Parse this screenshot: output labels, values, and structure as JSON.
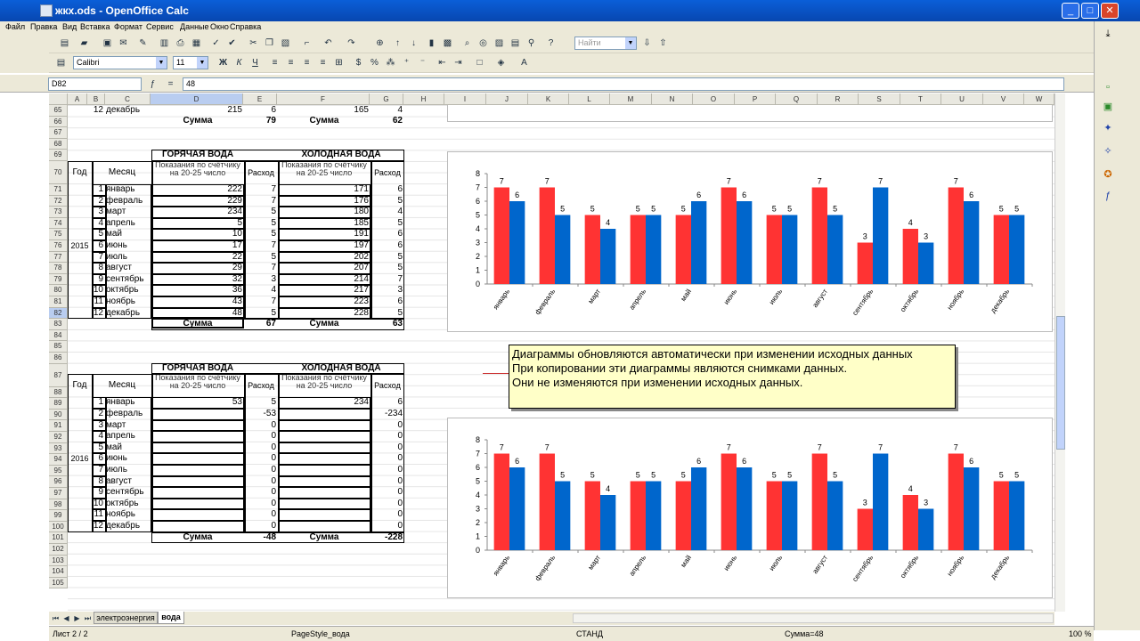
{
  "window": {
    "title": "жкх.ods - OpenOffice Calc",
    "min": "_",
    "max": "□",
    "close": "✕"
  },
  "menu": [
    "Файл",
    "Правка",
    "Вид",
    "Вставка",
    "Формат",
    "Сервис",
    "Данные",
    "Окно",
    "Справка"
  ],
  "toolbar": {
    "style_value": "Найти",
    "font_name": "Calibri",
    "font_size": "11"
  },
  "formula": {
    "cell_ref": "D82",
    "value": "48"
  },
  "columns": [
    "A",
    "B",
    "C",
    "D",
    "E",
    "F",
    "G",
    "H",
    "I",
    "J",
    "K",
    "L",
    "M",
    "N",
    "O",
    "P",
    "Q",
    "R",
    "S",
    "T",
    "U",
    "V",
    "W"
  ],
  "rows": [
    "65",
    "66",
    "67",
    "68",
    "69",
    "70",
    "71",
    "72",
    "73",
    "74",
    "75",
    "76",
    "77",
    "78",
    "79",
    "80",
    "81",
    "82",
    "83",
    "84",
    "85",
    "86",
    "87",
    "88",
    "89",
    "90",
    "91",
    "92",
    "93",
    "94",
    "95",
    "96",
    "97",
    "98",
    "99",
    "100",
    "101",
    "102",
    "103",
    "104",
    "105"
  ],
  "table_top": {
    "row65": {
      "num": "12",
      "month": "декабрь",
      "hot": "215",
      "hot_use": "6",
      "cold": "165",
      "cold_use": "4"
    },
    "row66": {
      "sum_label": "Сумма",
      "hot_sum": "79",
      "cold_sum": "62"
    }
  },
  "table2015": {
    "hot_header": "ГОРЯЧАЯ ВОДА",
    "cold_header": "ХОЛОДНАЯ ВОДА",
    "year_header": "Год",
    "month_header": "Месяц",
    "reading_header": "Показания по счётчику на 20-25 число",
    "use_header": "Расход",
    "year": "2015",
    "rows": [
      {
        "n": "1",
        "m": "январь",
        "h": "222",
        "hu": "7",
        "c": "171",
        "cu": "6"
      },
      {
        "n": "2",
        "m": "февраль",
        "h": "229",
        "hu": "7",
        "c": "176",
        "cu": "5"
      },
      {
        "n": "3",
        "m": "март",
        "h": "234",
        "hu": "5",
        "c": "180",
        "cu": "4"
      },
      {
        "n": "4",
        "m": "апрель",
        "h": "5",
        "hu": "5",
        "c": "185",
        "cu": "5"
      },
      {
        "n": "5",
        "m": "май",
        "h": "10",
        "hu": "5",
        "c": "191",
        "cu": "6"
      },
      {
        "n": "6",
        "m": "июнь",
        "h": "17",
        "hu": "7",
        "c": "197",
        "cu": "6"
      },
      {
        "n": "7",
        "m": "июль",
        "h": "22",
        "hu": "5",
        "c": "202",
        "cu": "5"
      },
      {
        "n": "8",
        "m": "август",
        "h": "29",
        "hu": "7",
        "c": "207",
        "cu": "5"
      },
      {
        "n": "9",
        "m": "сентябрь",
        "h": "32",
        "hu": "3",
        "c": "214",
        "cu": "7"
      },
      {
        "n": "10",
        "m": "октябрь",
        "h": "36",
        "hu": "4",
        "c": "217",
        "cu": "3"
      },
      {
        "n": "11",
        "m": "ноябрь",
        "h": "43",
        "hu": "7",
        "c": "223",
        "cu": "6"
      },
      {
        "n": "12",
        "m": "декабрь",
        "h": "48",
        "hu": "5",
        "c": "228",
        "cu": "5"
      }
    ],
    "sum_label": "Сумма",
    "hot_sum": "67",
    "cold_sum": "63"
  },
  "table2016": {
    "hot_header": "ГОРЯЧАЯ ВОДА",
    "cold_header": "ХОЛОДНАЯ ВОДА",
    "year_header": "Год",
    "month_header": "Месяц",
    "reading_header": "Показания по счётчику на 20-25 число",
    "use_header": "Расход",
    "year": "2016",
    "rows": [
      {
        "n": "1",
        "m": "январь",
        "h": "53",
        "hu": "5",
        "c": "234",
        "cu": "6"
      },
      {
        "n": "2",
        "m": "февраль",
        "h": "",
        "hu": "-53",
        "c": "",
        "cu": "-234"
      },
      {
        "n": "3",
        "m": "март",
        "h": "",
        "hu": "0",
        "c": "",
        "cu": "0"
      },
      {
        "n": "4",
        "m": "апрель",
        "h": "",
        "hu": "0",
        "c": "",
        "cu": "0"
      },
      {
        "n": "5",
        "m": "май",
        "h": "",
        "hu": "0",
        "c": "",
        "cu": "0"
      },
      {
        "n": "6",
        "m": "июнь",
        "h": "",
        "hu": "0",
        "c": "",
        "cu": "0"
      },
      {
        "n": "7",
        "m": "июль",
        "h": "",
        "hu": "0",
        "c": "",
        "cu": "0"
      },
      {
        "n": "8",
        "m": "август",
        "h": "",
        "hu": "0",
        "c": "",
        "cu": "0"
      },
      {
        "n": "9",
        "m": "сентябрь",
        "h": "",
        "hu": "0",
        "c": "",
        "cu": "0"
      },
      {
        "n": "10",
        "m": "октябрь",
        "h": "",
        "hu": "0",
        "c": "",
        "cu": "0"
      },
      {
        "n": "11",
        "m": "ноябрь",
        "h": "",
        "hu": "0",
        "c": "",
        "cu": "0"
      },
      {
        "n": "12",
        "m": "декабрь",
        "h": "",
        "hu": "0",
        "c": "",
        "cu": "0"
      }
    ],
    "sum_label": "Сумма",
    "hot_sum": "-48",
    "cold_sum": "-228"
  },
  "note": [
    "Диаграммы обновляются автоматически при изменении исходных данных",
    "При копировании эти диаграммы являются снимками данных.",
    "Они не изменяются при изменении исходных данных."
  ],
  "tabs": {
    "tab1": "электроэнергия",
    "tab2": "вода"
  },
  "status": {
    "sheet": "Лист 2 / 2",
    "page_style": "PageStyle_вода",
    "mode": "СТАНД",
    "sum": "Сумма=48",
    "zoom": "100 %"
  },
  "chart_data": [
    {
      "type": "bar",
      "categories": [
        "январь",
        "февраль",
        "март",
        "апрель",
        "май",
        "июнь",
        "июль",
        "август",
        "сентябрь",
        "октябрь",
        "ноябрь",
        "декабрь"
      ],
      "series": [
        {
          "values": [
            7,
            7,
            5,
            5,
            5,
            7,
            5,
            7,
            3,
            4,
            7,
            5
          ],
          "color": "#ff3333"
        },
        {
          "values": [
            6,
            5,
            4,
            5,
            6,
            6,
            5,
            5,
            7,
            3,
            6,
            5
          ],
          "color": "#0066cc"
        }
      ],
      "ylim": [
        0,
        8
      ],
      "yticks": [
        0,
        1,
        2,
        3,
        4,
        5,
        6,
        7,
        8
      ],
      "grid": false
    },
    {
      "type": "bar",
      "categories": [
        "январь",
        "февраль",
        "март",
        "апрель",
        "май",
        "июнь",
        "июль",
        "август",
        "сентябрь",
        "октябрь",
        "ноябрь",
        "декабрь"
      ],
      "series": [
        {
          "values": [
            7,
            7,
            5,
            5,
            5,
            7,
            5,
            7,
            3,
            4,
            7,
            5
          ],
          "color": "#ff3333"
        },
        {
          "values": [
            6,
            5,
            4,
            5,
            6,
            6,
            5,
            5,
            7,
            3,
            6,
            5
          ],
          "color": "#0066cc"
        }
      ],
      "ylim": [
        0,
        8
      ],
      "yticks": [
        0,
        1,
        2,
        3,
        4,
        5,
        6,
        7,
        8
      ],
      "grid": false
    }
  ]
}
